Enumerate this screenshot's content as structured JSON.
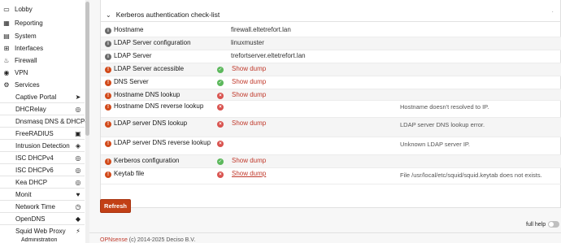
{
  "sidebar": {
    "items": [
      {
        "label": "Lobby",
        "icon": "laptop-icon",
        "glyph": "▭"
      },
      {
        "label": "Reporting",
        "icon": "chart-icon",
        "glyph": "▦"
      },
      {
        "label": "System",
        "icon": "server-icon",
        "glyph": "▤"
      },
      {
        "label": "Interfaces",
        "icon": "sitemap-icon",
        "glyph": "⊞"
      },
      {
        "label": "Firewall",
        "icon": "fire-icon",
        "glyph": "♨"
      },
      {
        "label": "VPN",
        "icon": "globe-icon",
        "glyph": "◉"
      },
      {
        "label": "Services",
        "icon": "gears-icon",
        "glyph": "⚙"
      }
    ],
    "services": [
      {
        "label": "Captive Portal",
        "icon": "send-icon",
        "glyph": "➤"
      },
      {
        "label": "DHCRelay",
        "icon": "bullseye-icon",
        "glyph": "◎"
      },
      {
        "label": "Dnsmasq DNS & DHCP",
        "icon": "tags-icon",
        "glyph": "◆"
      },
      {
        "label": "FreeRADIUS",
        "icon": "list-icon",
        "glyph": "▣"
      },
      {
        "label": "Intrusion Detection",
        "icon": "shield-icon",
        "glyph": "◈"
      },
      {
        "label": "ISC DHCPv4",
        "icon": "bullseye-icon",
        "glyph": "◎"
      },
      {
        "label": "ISC DHCPv6",
        "icon": "bullseye-icon",
        "glyph": "◎"
      },
      {
        "label": "Kea DHCP",
        "icon": "bullseye-icon",
        "glyph": "◎"
      },
      {
        "label": "Monit",
        "icon": "heartbeat-icon",
        "glyph": "♥"
      },
      {
        "label": "Network Time",
        "icon": "clock-icon",
        "glyph": "◷"
      },
      {
        "label": "OpenDNS",
        "icon": "tags-icon",
        "glyph": "◆"
      },
      {
        "label": "Squid Web Proxy",
        "icon": "bolt-icon",
        "glyph": "⚡"
      }
    ],
    "cut_item": "Administration"
  },
  "panel": {
    "chevron": "⌄",
    "title": "Kerberos authentication check-list"
  },
  "rows": [
    {
      "icon": "info",
      "label": "Hostname",
      "value": "firewall.eltetrefort.lan",
      "status": "",
      "dump": "",
      "message": ""
    },
    {
      "icon": "info",
      "label": "LDAP Server configuration",
      "value": "linuxmuster",
      "status": "",
      "dump": "",
      "message": ""
    },
    {
      "icon": "info",
      "label": "LDAP Server",
      "value": "trefortserver.eltetrefort.lan",
      "status": "",
      "dump": "",
      "message": ""
    },
    {
      "icon": "warn",
      "label": "LDAP Server accessible",
      "value": "",
      "status": "ok",
      "dump": "Show dump",
      "message": ""
    },
    {
      "icon": "warn",
      "label": "DNS Server",
      "value": "",
      "status": "ok",
      "dump": "Show dump",
      "message": ""
    },
    {
      "icon": "warn",
      "label": "Hostname DNS lookup",
      "value": "",
      "status": "err",
      "dump": "Show dump",
      "message": ""
    },
    {
      "icon": "warn",
      "label": "Hostname DNS reverse lookup",
      "value": "",
      "status": "err",
      "dump": "",
      "message": "Hostname doesn't resolved to IP."
    },
    {
      "icon": "warn",
      "label": "LDAP server DNS lookup",
      "value": "",
      "status": "err",
      "dump": "Show dump",
      "message": "LDAP server DNS lookup error."
    },
    {
      "icon": "warn",
      "label": "LDAP server DNS reverse lookup",
      "value": "",
      "status": "err",
      "dump": "",
      "message": "Unknown LDAP server IP."
    },
    {
      "icon": "warn",
      "label": "Kerberos configuration",
      "value": "",
      "status": "ok",
      "dump": "Show dump",
      "message": ""
    },
    {
      "icon": "warn",
      "label": "Keytab file",
      "value": "",
      "status": "err",
      "dump": "Show dump",
      "message": "File /usr/local/etc/squid/squid.keytab does not exists."
    }
  ],
  "refresh_label": "Refresh",
  "full_help_label": "full help",
  "footer": {
    "brand": "OPNsense",
    "copyright": " (c) 2014-2025 Deciso B.V."
  },
  "colors": {
    "accent": "#c24016",
    "ok": "#5cb85c",
    "error": "#d9534f",
    "warning_icon": "#d24a1a"
  }
}
